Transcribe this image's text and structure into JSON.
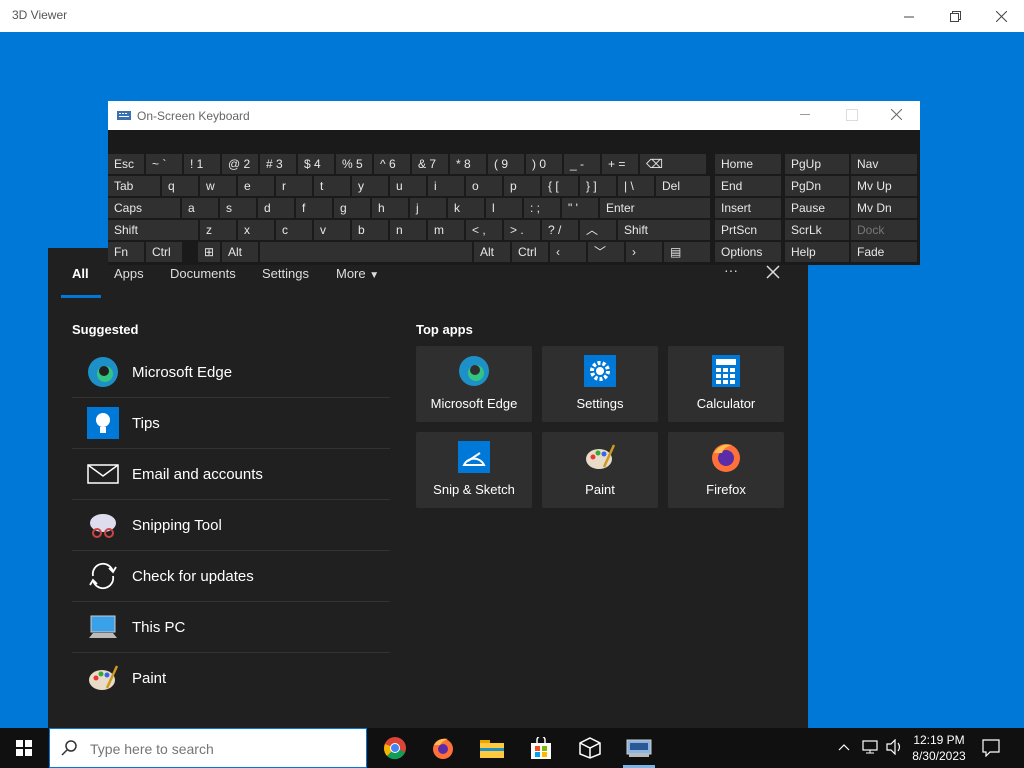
{
  "window": {
    "title": "3D Viewer"
  },
  "search_panel": {
    "tabs": [
      "All",
      "Apps",
      "Documents",
      "Settings",
      "More"
    ],
    "suggested_title": "Suggested",
    "suggested": [
      "Microsoft Edge",
      "Tips",
      "Email and accounts",
      "Snipping Tool",
      "Check for updates",
      "This PC",
      "Paint"
    ],
    "top_apps_title": "Top apps",
    "top_apps": [
      "Microsoft Edge",
      "Settings",
      "Calculator",
      "Snip & Sketch",
      "Paint",
      "Firefox"
    ],
    "more_options": "···"
  },
  "osk": {
    "title": "On-Screen Keyboard",
    "row1": [
      "Esc",
      "~ `",
      "! 1",
      "@ 2",
      "# 3",
      "$ 4",
      "% 5",
      "^ 6",
      "& 7",
      "* 8",
      "( 9",
      ") 0",
      "_ -",
      "+ ="
    ],
    "row2": [
      "Tab",
      "q",
      "w",
      "e",
      "r",
      "t",
      "y",
      "u",
      "i",
      "o",
      "p",
      "{ [",
      "} ]",
      "| \\",
      "Del"
    ],
    "row3": [
      "Caps",
      "a",
      "s",
      "d",
      "f",
      "g",
      "h",
      "j",
      "k",
      "l",
      ": ;",
      "\" '",
      "Enter"
    ],
    "row4": [
      "Shift",
      "z",
      "x",
      "c",
      "v",
      "b",
      "n",
      "m",
      "< ,",
      "> .",
      "? /",
      "Shift"
    ],
    "row5": [
      "Fn",
      "Ctrl",
      "Alt",
      "Alt",
      "Ctrl"
    ],
    "nav": [
      [
        "Home",
        "PgUp",
        "Nav"
      ],
      [
        "End",
        "PgDn",
        "Mv Up"
      ],
      [
        "Insert",
        "Pause",
        "Mv Dn"
      ],
      [
        "PrtScn",
        "ScrLk",
        "Dock"
      ],
      [
        "Options",
        "Help",
        "Fade"
      ]
    ]
  },
  "taskbar": {
    "search_placeholder": "Type here to search",
    "time": "12:19 PM",
    "date": "8/30/2023"
  },
  "colors": {
    "accent": "#0078d7",
    "panel": "#202020",
    "tile": "#2f2f2f"
  }
}
